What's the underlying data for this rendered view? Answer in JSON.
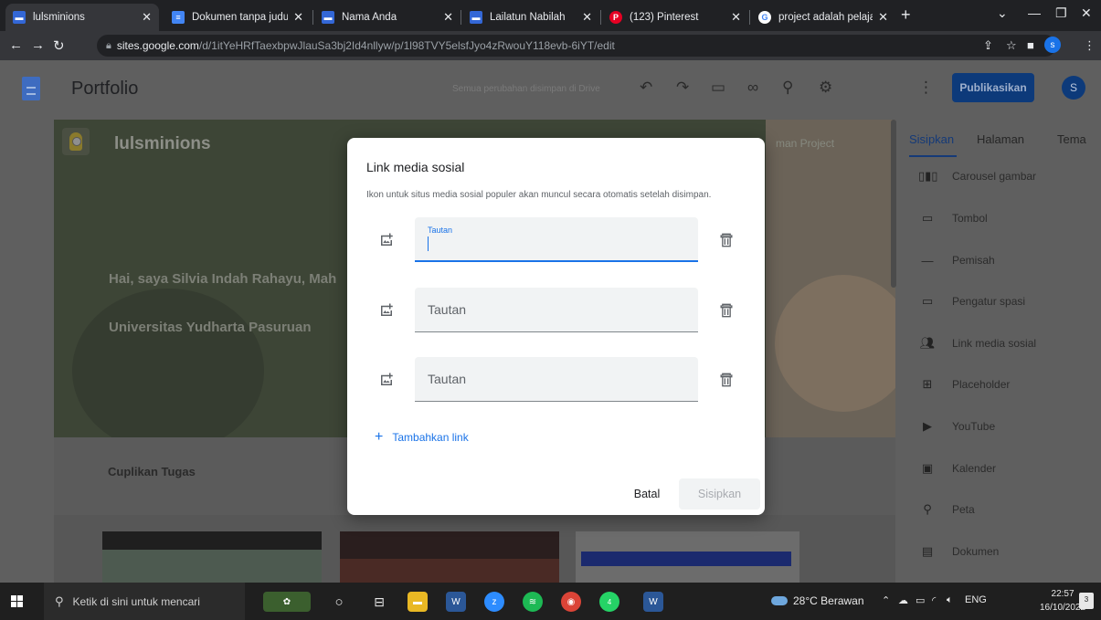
{
  "browser": {
    "tabs": [
      {
        "title": "lulsminions",
        "favicon": "sites-icon",
        "active": true
      },
      {
        "title": "Dokumen tanpa judul",
        "favicon": "docs-icon"
      },
      {
        "title": "Nama Anda",
        "favicon": "sites-icon"
      },
      {
        "title": "Lailatun Nabilah",
        "favicon": "sites-icon"
      },
      {
        "title": "(123) Pinterest",
        "favicon": "pinterest-icon"
      },
      {
        "title": "project adalah pelajar",
        "favicon": "google-icon"
      }
    ],
    "url_host": "sites.google.com",
    "url_path": "/d/1itYeHRfTaexbpwJlauSa3bj2Id4nllyw/p/1l98TVY5elsfJyo4zRwouY118evb-6iYT/edit",
    "profile_initial": "s"
  },
  "editor": {
    "title": "Portfolio",
    "save_status": "Semua perubahan disimpan di Drive",
    "publish_label": "Publikasikan",
    "avatar_initial": "S"
  },
  "site": {
    "name": "lulsminions",
    "nav_item": "man Project",
    "hero_line1": "Hai, saya Silvia Indah Rahayu, Mah",
    "hero_line2": "Universitas Yudharta Pasuruan",
    "section_label": "Cuplikan Tugas"
  },
  "side_panel": {
    "tabs": [
      "Sisipkan",
      "Halaman",
      "Tema"
    ],
    "active_tab": "Sisipkan",
    "items": [
      {
        "label": "Carousel gambar",
        "icon": "carousel-icon"
      },
      {
        "label": "Tombol",
        "icon": "button-icon"
      },
      {
        "label": "Pemisah",
        "icon": "divider-icon"
      },
      {
        "label": "Pengatur spasi",
        "icon": "spacer-icon"
      },
      {
        "label": "Link media sosial",
        "icon": "people-icon"
      },
      {
        "label": "Placeholder",
        "icon": "plus-box-icon"
      },
      {
        "label": "YouTube",
        "icon": "youtube-icon"
      },
      {
        "label": "Kalender",
        "icon": "calendar-icon"
      },
      {
        "label": "Peta",
        "icon": "map-pin-icon"
      },
      {
        "label": "Dokumen",
        "icon": "document-icon"
      }
    ]
  },
  "dialog": {
    "title": "Link media sosial",
    "description": "Ikon untuk situs media sosial populer akan muncul secara otomatis setelah disimpan.",
    "links": [
      {
        "label": "Tautan",
        "value": "",
        "focused": true
      },
      {
        "label": "Tautan",
        "value": "",
        "focused": false
      },
      {
        "label": "Tautan",
        "value": "",
        "focused": false
      }
    ],
    "add_link_label": "Tambahkan link",
    "cancel_label": "Batal",
    "insert_label": "Sisipkan"
  },
  "taskbar": {
    "search_placeholder": "Ketik di sini untuk mencari",
    "weather": "28°C Berawan",
    "language": "ENG",
    "time": "22:57",
    "date": "16/10/2022",
    "whatsapp_badge": "4",
    "notifications": "3"
  },
  "colors": {
    "accent": "#1a73e8",
    "publish_bg": "#0d3a7a",
    "site_bg": "#3d4536"
  }
}
